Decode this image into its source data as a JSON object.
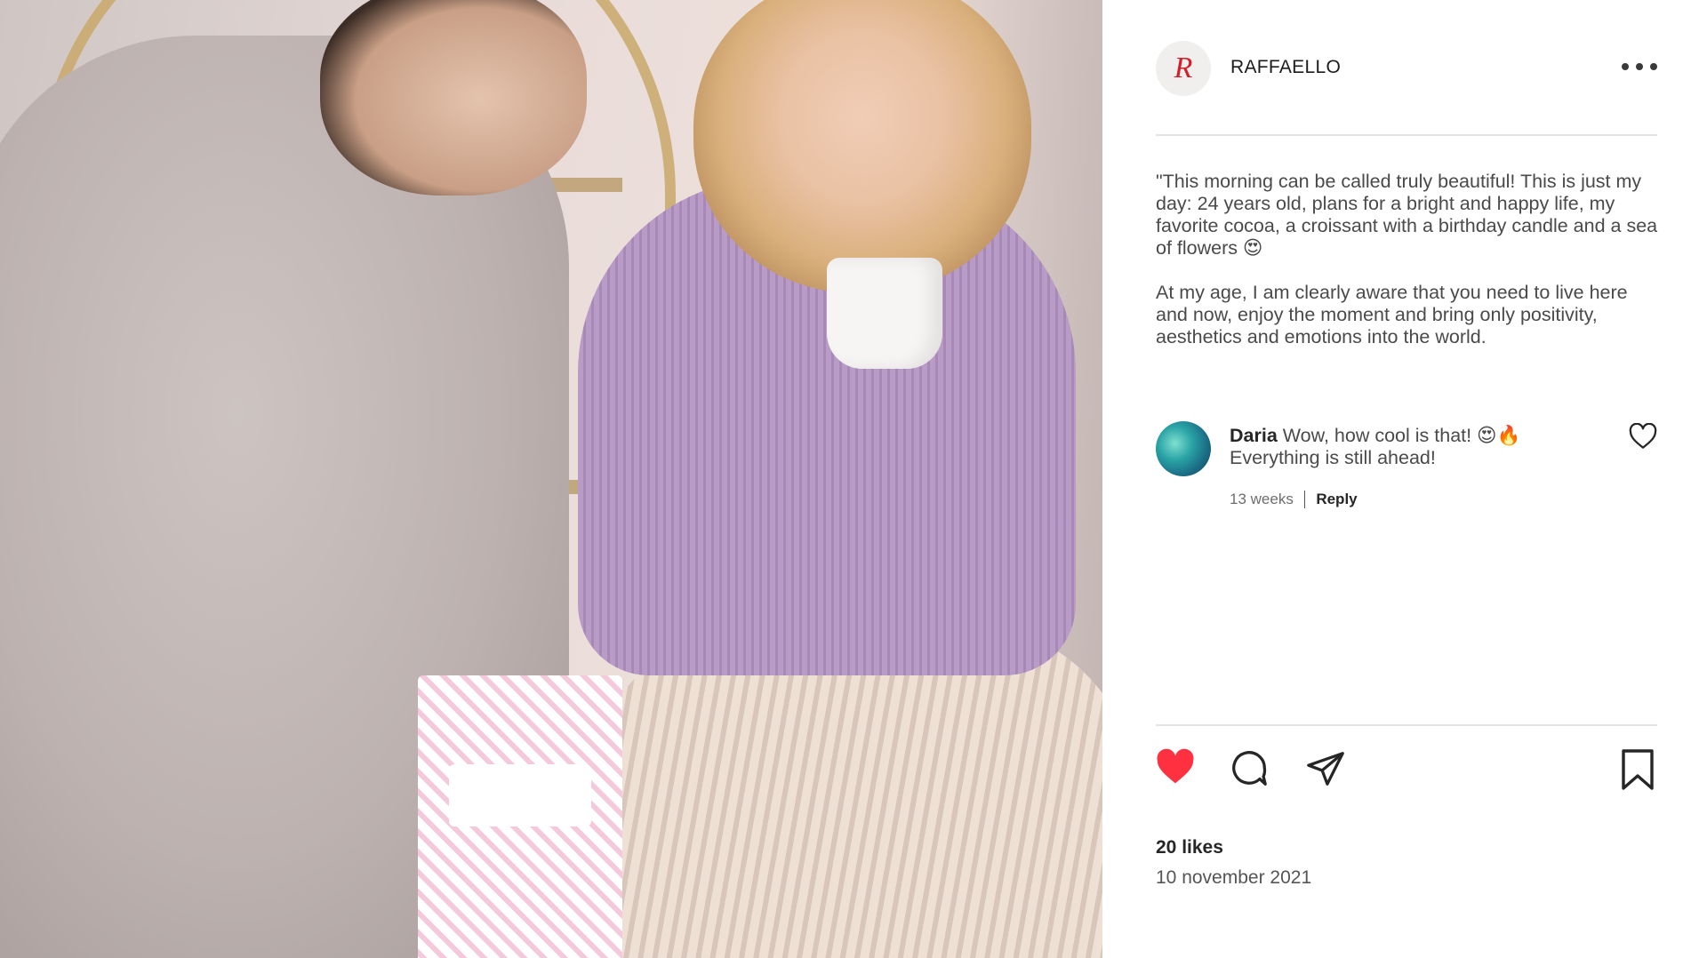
{
  "post": {
    "account": {
      "username": "RAFFAELLO",
      "avatar_letter": "R",
      "brand_color": "#d21f2b"
    },
    "menu_icon": "more-horizontal-icon",
    "caption": [
      "\"This morning can be called truly beautiful! This is just my day: 24 years old, plans for a bright and happy life, my favorite cocoa, a croissant with a birthday candle and a sea of flowers 😍",
      "At my age, I am clearly aware that you need to live here and now, enjoy the moment and bring only positivity, aesthetics and emotions into the world."
    ],
    "comments": [
      {
        "author": "Daria",
        "text_line1": "Wow, how cool is that! 😍🔥",
        "text_line2": "Everything is still ahead!",
        "age": "13 weeks",
        "reply_label": "Reply"
      }
    ],
    "actions": {
      "like_icon": "heart-filled-icon",
      "like_color": "#ff3040",
      "comment_icon": "comment-bubble-icon",
      "share_icon": "paper-plane-icon",
      "save_icon": "bookmark-icon"
    },
    "likes": "20 likes",
    "date": "10 november 2021"
  }
}
